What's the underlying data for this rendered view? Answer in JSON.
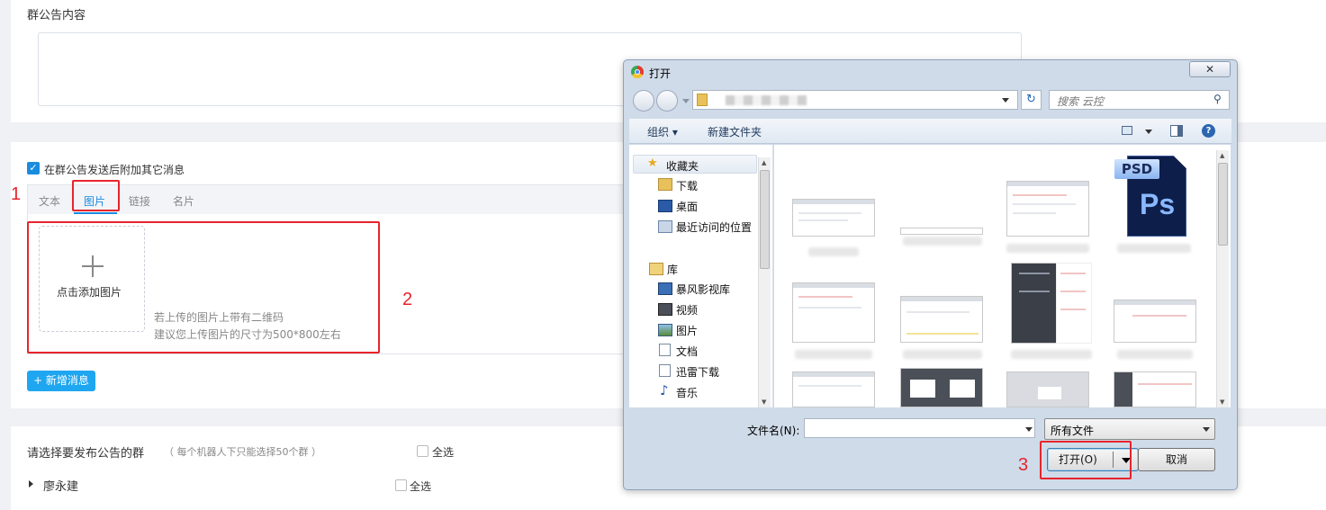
{
  "announcement": {
    "content_label": "群公告内容"
  },
  "attach": {
    "checkbox_label": "在群公告发送后附加其它消息",
    "tabs": [
      "文本",
      "图片",
      "链接",
      "名片"
    ],
    "upload_label": "点击添加图片",
    "hint_line1": "若上传的图片上带有二维码",
    "hint_line2": "建议您上传图片的尺寸为500*800左右",
    "add_message_button": "+ 新增消息"
  },
  "groups": {
    "title": "请选择要发布公告的群",
    "limit_note": "（ 每个机器人下只能选择50个群 ）",
    "select_all_top": "全选",
    "owner_name": "廖永建",
    "select_all_owner": "全选"
  },
  "annotations": {
    "step1": "1",
    "step2": "2",
    "step3": "3",
    "color": "#e8242c"
  },
  "dialog": {
    "title": "打开",
    "search_placeholder": "搜索 云控",
    "toolbar": {
      "organize": "组织 ▾",
      "new_folder": "新建文件夹"
    },
    "nav": {
      "favorites_header": "收藏夹",
      "favorites": [
        "下载",
        "桌面",
        "最近访问的位置"
      ],
      "library_header": "库",
      "libraries": [
        "暴风影视库",
        "视频",
        "图片",
        "文档",
        "迅雷下载",
        "音乐"
      ]
    },
    "psd_label": "PSD",
    "ps_label": "Ps",
    "filename_label": "文件名(N):",
    "filename_value": "",
    "filetype_value": "所有文件",
    "open_button": "打开(O)",
    "cancel_button": "取消"
  }
}
